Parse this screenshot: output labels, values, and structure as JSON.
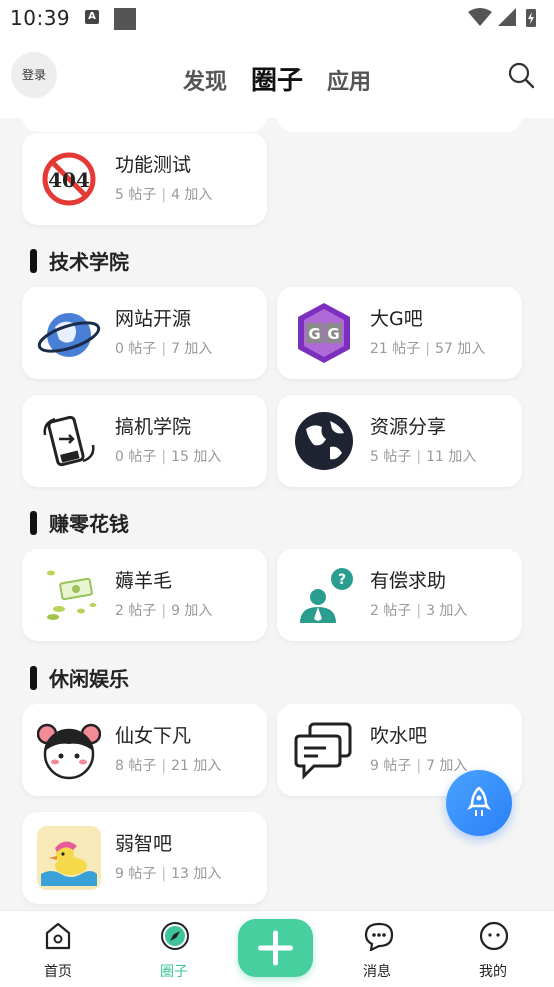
{
  "status_bar": {
    "time": "10:39",
    "a_icon": "A"
  },
  "header": {
    "login": "登录",
    "tabs": [
      "发现",
      "圈子",
      "应用"
    ],
    "active_tab": "圈子"
  },
  "top_card": {
    "name": "功能测试",
    "posts": "5 帖子",
    "joins": "4 加入",
    "icon": "404-icon"
  },
  "sections": [
    {
      "title": "技术学院",
      "cards": [
        {
          "name": "网站开源",
          "posts": "0 帖子",
          "joins": "7 加入",
          "icon": "planet-icon"
        },
        {
          "name": "大G吧",
          "posts": "21 帖子",
          "joins": "57 加入",
          "icon": "gg-icon"
        },
        {
          "name": "搞机学院",
          "posts": "0 帖子",
          "joins": "15 加入",
          "icon": "phone-rotate-icon"
        },
        {
          "name": "资源分享",
          "posts": "5 帖子",
          "joins": "11 加入",
          "icon": "globe-icon"
        }
      ]
    },
    {
      "title": "赚零花钱",
      "cards": [
        {
          "name": "薅羊毛",
          "posts": "2 帖子",
          "joins": "9 加入",
          "icon": "money-icon"
        },
        {
          "name": "有偿求助",
          "posts": "2 帖子",
          "joins": "3 加入",
          "icon": "help-person-icon"
        }
      ]
    },
    {
      "title": "休闲娱乐",
      "cards": [
        {
          "name": "仙女下凡",
          "posts": "8 帖子",
          "joins": "21 加入",
          "icon": "girl-icon"
        },
        {
          "name": "吹水吧",
          "posts": "9 帖子",
          "joins": "7 加入",
          "icon": "chat-bubbles-icon"
        },
        {
          "name": "弱智吧",
          "posts": "9 帖子",
          "joins": "13 加入",
          "icon": "duck-icon"
        }
      ]
    }
  ],
  "bottom_nav": {
    "items": [
      "首页",
      "圈子",
      "消息",
      "我的"
    ],
    "active": "圈子"
  },
  "colors": {
    "accent": "#3cc49a",
    "fab": "#2a7ff7"
  }
}
